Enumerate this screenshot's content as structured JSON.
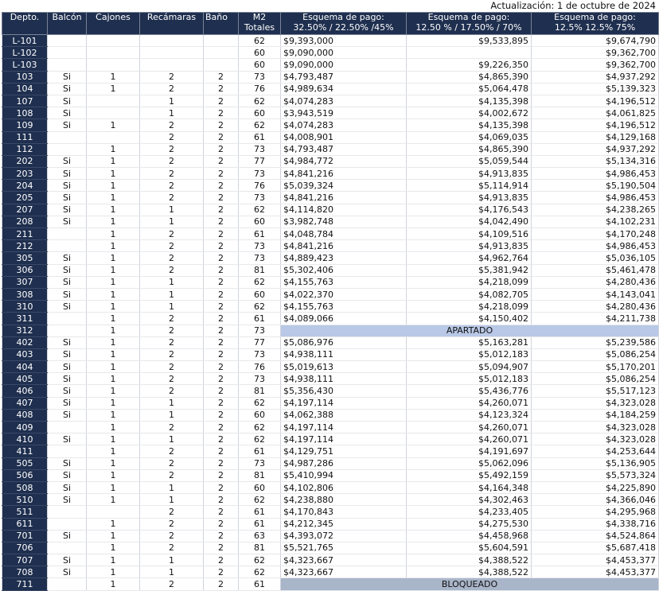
{
  "update_label": "Actualización: 1 de octubre de 2024",
  "headers": {
    "depto": "Depto.",
    "balcon": "Balcón",
    "cajones": "Cajones",
    "recamaras": "Recámaras",
    "bano": "Baño",
    "m2_line1": "M2",
    "m2_line2": "Totales",
    "esq1_line1": "Esquema de pago:",
    "esq1_line2": "32.50% / 22.50% /45%",
    "esq2_line1": "Esquema de pago:",
    "esq2_line2": "12.50 %  / 17.50% / 70%",
    "esq3_line1": "Esquema de pago:",
    "esq3_line2": "12.5% 12.5% 75%"
  },
  "rows": [
    [
      "L-101",
      "",
      "",
      "",
      "",
      "62",
      "$9,393,000",
      "$9,533,895",
      "$9,674,790"
    ],
    [
      "L-102",
      "",
      "",
      "",
      "",
      "60",
      "$9,090,000",
      "",
      "$9,362,700"
    ],
    [
      "L-103",
      "",
      "",
      "",
      "",
      "60",
      "$9,090,000",
      "$9,226,350",
      "$9,362,700"
    ],
    [
      "103",
      "Si",
      "1",
      "2",
      "2",
      "73",
      "$4,793,487",
      "$4,865,390",
      "$4,937,292"
    ],
    [
      "104",
      "Si",
      "1",
      "2",
      "2",
      "76",
      "$4,989,634",
      "$5,064,478",
      "$5,139,323"
    ],
    [
      "107",
      "Si",
      "",
      "1",
      "2",
      "62",
      "$4,074,283",
      "$4,135,398",
      "$4,196,512"
    ],
    [
      "108",
      "Si",
      "",
      "1",
      "2",
      "60",
      "$3,943,519",
      "$4,002,672",
      "$4,061,825"
    ],
    [
      "109",
      "Si",
      "1",
      "2",
      "2",
      "62",
      "$4,074,283",
      "$4,135,398",
      "$4,196,512"
    ],
    [
      "111",
      "",
      "",
      "2",
      "2",
      "61",
      "$4,008,901",
      "$4,069,035",
      "$4,129,168"
    ],
    [
      "112",
      "",
      "1",
      "2",
      "2",
      "73",
      "$4,793,487",
      "$4,865,390",
      "$4,937,292"
    ],
    [
      "202",
      "Si",
      "1",
      "2",
      "2",
      "77",
      "$4,984,772",
      "$5,059,544",
      "$5,134,316"
    ],
    [
      "203",
      "Si",
      "1",
      "2",
      "2",
      "73",
      "$4,841,216",
      "$4,913,835",
      "$4,986,453"
    ],
    [
      "204",
      "Si",
      "1",
      "2",
      "2",
      "76",
      "$5,039,324",
      "$5,114,914",
      "$5,190,504"
    ],
    [
      "205",
      "Si",
      "1",
      "2",
      "2",
      "73",
      "$4,841,216",
      "$4,913,835",
      "$4,986,453"
    ],
    [
      "207",
      "Si",
      "1",
      "1",
      "2",
      "62",
      "$4,114,820",
      "$4,176,543",
      "$4,238,265"
    ],
    [
      "208",
      "Si",
      "1",
      "1",
      "2",
      "60",
      "$3,982,748",
      "$4,042,490",
      "$4,102,231"
    ],
    [
      "211",
      "",
      "1",
      "2",
      "2",
      "61",
      "$4,048,784",
      "$4,109,516",
      "$4,170,248"
    ],
    [
      "212",
      "",
      "1",
      "2",
      "2",
      "73",
      "$4,841,216",
      "$4,913,835",
      "$4,986,453"
    ],
    [
      "305",
      "Si",
      "1",
      "2",
      "2",
      "73",
      "$4,889,423",
      "$4,962,764",
      "$5,036,105"
    ],
    [
      "306",
      "Si",
      "1",
      "2",
      "2",
      "81",
      "$5,302,406",
      "$5,381,942",
      "$5,461,478"
    ],
    [
      "307",
      "Si",
      "1",
      "1",
      "2",
      "62",
      "$4,155,763",
      "$4,218,099",
      "$4,280,436"
    ],
    [
      "308",
      "Si",
      "1",
      "1",
      "2",
      "60",
      "$4,022,370",
      "$4,082,705",
      "$4,143,041"
    ],
    [
      "310",
      "Si",
      "1",
      "1",
      "2",
      "62",
      "$4,155,763",
      "$4,218,099",
      "$4,280,436"
    ],
    [
      "311",
      "",
      "1",
      "2",
      "2",
      "61",
      "$4,089,066",
      "$4,150,402",
      "$4,211,738"
    ],
    [
      "312",
      "",
      "1",
      "2",
      "2",
      "73",
      "APARTADO"
    ],
    [
      "402",
      "Si",
      "1",
      "2",
      "2",
      "77",
      "$5,086,976",
      "$5,163,281",
      "$5,239,586"
    ],
    [
      "403",
      "Si",
      "1",
      "2",
      "2",
      "73",
      "$4,938,111",
      "$5,012,183",
      "$5,086,254"
    ],
    [
      "404",
      "Si",
      "1",
      "2",
      "2",
      "76",
      "$5,019,613",
      "$5,094,907",
      "$5,170,201"
    ],
    [
      "405",
      "Si",
      "1",
      "2",
      "2",
      "73",
      "$4,938,111",
      "$5,012,183",
      "$5,086,254"
    ],
    [
      "406",
      "Si",
      "1",
      "2",
      "2",
      "81",
      "$5,356,430",
      "$5,436,776",
      "$5,517,123"
    ],
    [
      "407",
      "Si",
      "1",
      "1",
      "2",
      "62",
      "$4,197,114",
      "$4,260,071",
      "$4,323,028"
    ],
    [
      "408",
      "Si",
      "1",
      "1",
      "2",
      "60",
      "$4,062,388",
      "$4,123,324",
      "$4,184,259"
    ],
    [
      "409",
      "",
      "1",
      "2",
      "2",
      "62",
      "$4,197,114",
      "$4,260,071",
      "$4,323,028"
    ],
    [
      "410",
      "Si",
      "1",
      "1",
      "2",
      "62",
      "$4,197,114",
      "$4,260,071",
      "$4,323,028"
    ],
    [
      "411",
      "",
      "1",
      "2",
      "2",
      "61",
      "$4,129,751",
      "$4,191,697",
      "$4,253,644"
    ],
    [
      "505",
      "Si",
      "1",
      "2",
      "2",
      "73",
      "$4,987,286",
      "$5,062,096",
      "$5,136,905"
    ],
    [
      "506",
      "Si",
      "1",
      "2",
      "2",
      "81",
      "$5,410,994",
      "$5,492,159",
      "$5,573,324"
    ],
    [
      "508",
      "Si",
      "1",
      "1",
      "2",
      "60",
      "$4,102,806",
      "$4,164,348",
      "$4,225,890"
    ],
    [
      "510",
      "Si",
      "1",
      "1",
      "2",
      "62",
      "$4,238,880",
      "$4,302,463",
      "$4,366,046"
    ],
    [
      "511",
      "",
      "",
      "2",
      "2",
      "61",
      "$4,170,843",
      "$4,233,405",
      "$4,295,968"
    ],
    [
      "611",
      "",
      "1",
      "2",
      "2",
      "61",
      "$4,212,345",
      "$4,275,530",
      "$4,338,716"
    ],
    [
      "701",
      "Si",
      "1",
      "2",
      "2",
      "63",
      "$4,393,072",
      "$4,458,968",
      "$4,524,864"
    ],
    [
      "706",
      "",
      "1",
      "2",
      "2",
      "81",
      "$5,521,765",
      "$5,604,591",
      "$5,687,418"
    ],
    [
      "707",
      "Si",
      "1",
      "1",
      "2",
      "62",
      "$4,323,667",
      "$4,388,522",
      "$4,453,377"
    ],
    [
      "708",
      "Si",
      "1",
      "1",
      "2",
      "62",
      "$4,323,667",
      "$4,388,522",
      "$4,453,377"
    ],
    [
      "711",
      "",
      "1",
      "2",
      "2",
      "61",
      "BLOQUEADO"
    ]
  ]
}
